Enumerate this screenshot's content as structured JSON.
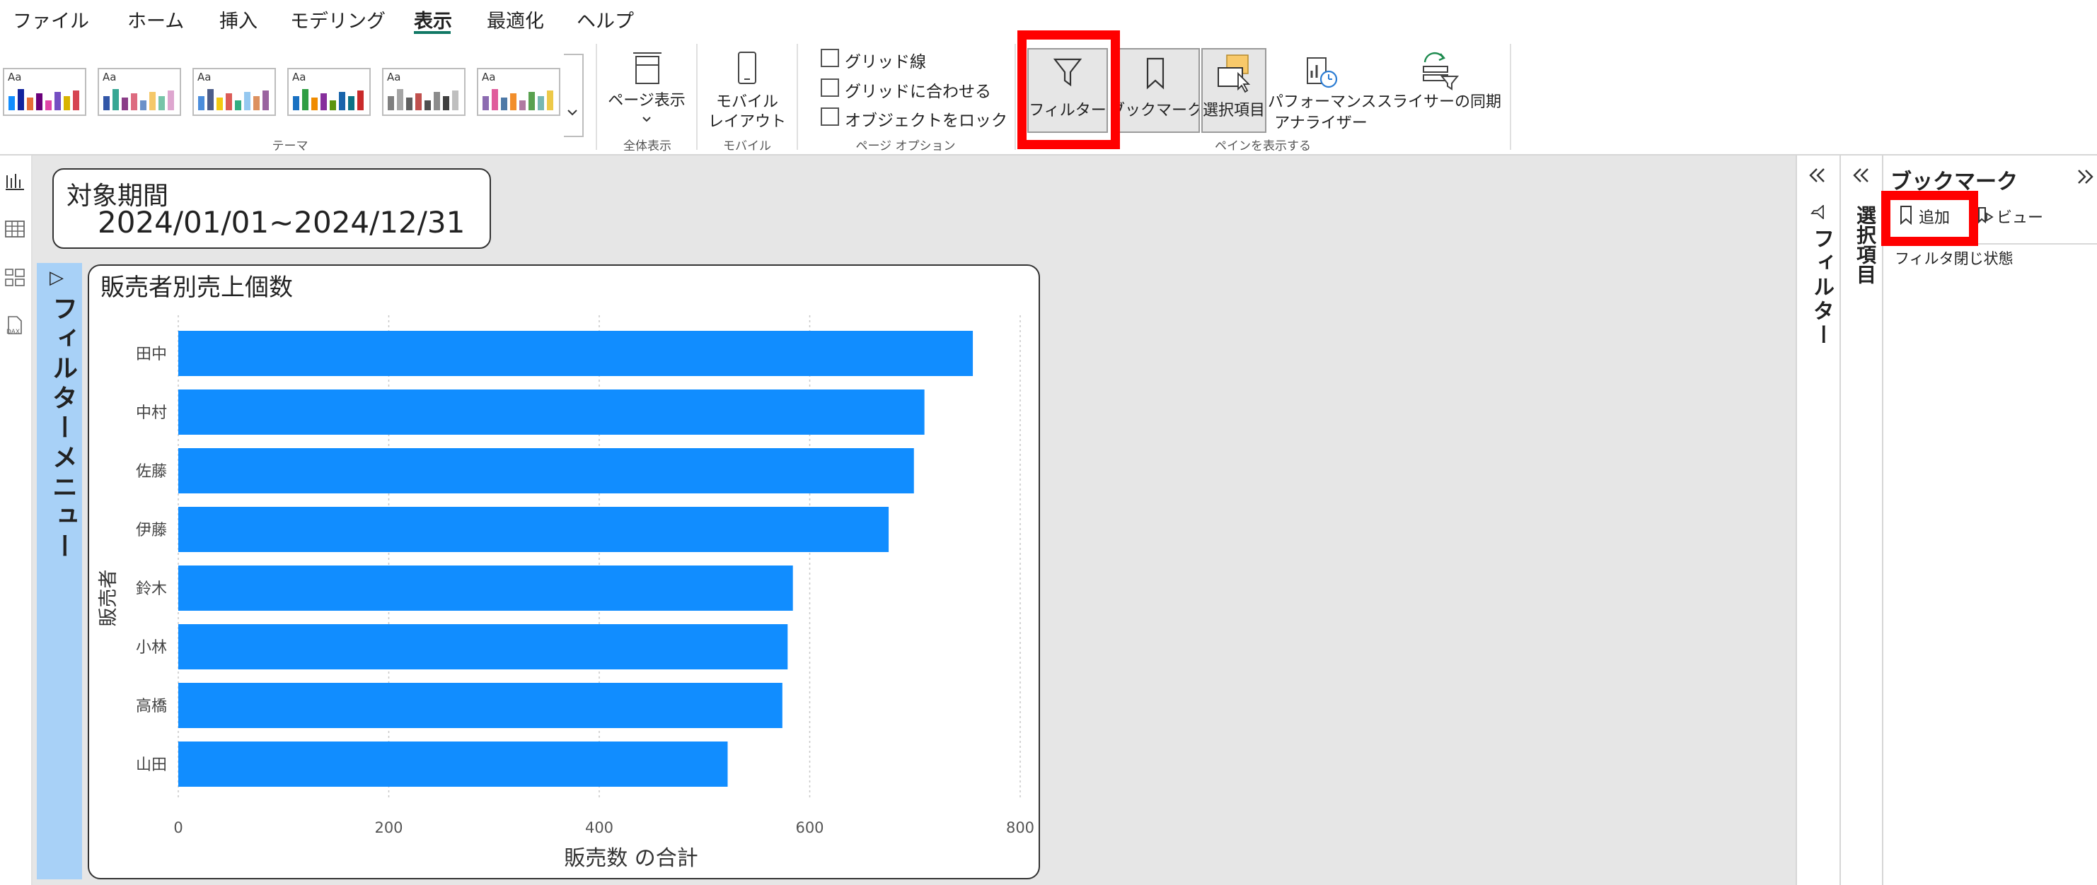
{
  "menu": {
    "items": [
      "ファイル",
      "ホーム",
      "挿入",
      "モデリング",
      "表示",
      "最適化",
      "ヘルプ"
    ],
    "active": "表示"
  },
  "ribbon": {
    "themes_group_label": "テーマ",
    "page_view": {
      "label": "ページ表示",
      "group": "全体表示"
    },
    "mobile_layout": {
      "line1": "モバイル",
      "line2": "レイアウト",
      "group": "モバイル"
    },
    "page_options": {
      "gridlines": "グリッド線",
      "snap_to_grid": "グリッドに合わせる",
      "lock_objects": "オブジェクトをロック",
      "group": "ページ オプション"
    },
    "panes": {
      "filter": "フィルター",
      "bookmark": "ブックマーク",
      "selection": "選択項目",
      "performance_line1": "パフォーマンス",
      "performance_line2": "アナライザー",
      "sync_slicers": "スライサーの同期",
      "group": "ペインを表示する"
    }
  },
  "date_card": {
    "title": "対象期間",
    "range": "2024/01/01~2024/12/31"
  },
  "filter_menu_tab": {
    "arrow": "▷",
    "label": "フィルターメニュー"
  },
  "chart_data": {
    "type": "bar",
    "orientation": "horizontal",
    "title": "販売者別売上個数",
    "xlabel": "販売数 の合計",
    "ylabel": "販売者",
    "categories": [
      "田中",
      "中村",
      "佐藤",
      "伊藤",
      "鈴木",
      "小林",
      "高橋",
      "山田"
    ],
    "values": [
      755,
      709,
      699,
      675,
      584,
      579,
      574,
      522
    ],
    "xlim": [
      0,
      800
    ],
    "xticks": [
      0,
      200,
      400,
      600,
      800
    ],
    "grid": true,
    "bar_color": "#118DFF"
  },
  "right_panes": {
    "filter_pane_label": "フィルター",
    "selection_pane_label": "選択項目",
    "bookmark": {
      "title": "ブックマーク",
      "add_label": "追加",
      "view_label": "ビュー",
      "items": [
        "フィルタ閉じ状態"
      ]
    }
  },
  "colors": {
    "accent_underline": "#117865",
    "highlight_box": "#ff0000",
    "bar": "#118DFF",
    "filter_tab": "#a8d1f7"
  }
}
